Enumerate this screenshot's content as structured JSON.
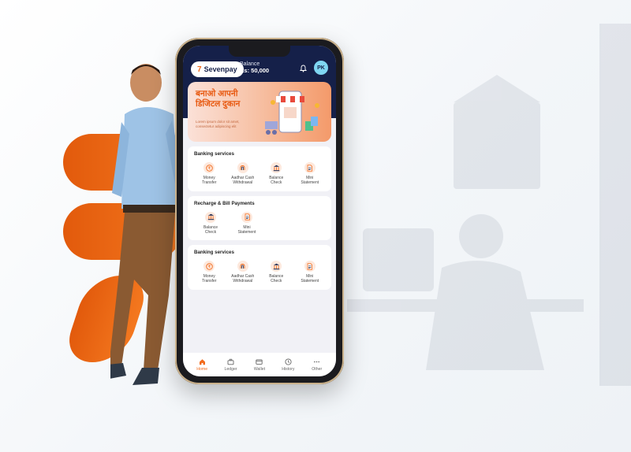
{
  "colors": {
    "brand_navy": "#152049",
    "accent_orange": "#f26a1b",
    "screen_bg": "#f1f1f6"
  },
  "header": {
    "logo_text": "Sevenpay",
    "balance_label": "Balance",
    "balance_value": "Rs: 50,000",
    "bell_icon": "bell-icon",
    "avatar_initials": "PK"
  },
  "banner": {
    "title_line1": "बनाओ आपनी",
    "title_line2": "डिजिटल दुकान",
    "subtitle": "Lorem ipsum dolor sit amet, consectetur adipiscing elit"
  },
  "sections": [
    {
      "title": "Banking services",
      "items": [
        {
          "label_line1": "Money",
          "label_line2": "Transfer",
          "icon": "rupee-icon"
        },
        {
          "label_line1": "Aadhar Cash",
          "label_line2": "Withdrawal",
          "icon": "fingerprint-icon"
        },
        {
          "label_line1": "Balance",
          "label_line2": "Check",
          "icon": "bank-icon"
        },
        {
          "label_line1": "Mini",
          "label_line2": "Statement",
          "icon": "document-icon"
        }
      ]
    },
    {
      "title": "Recharge & Bill Payments",
      "items": [
        {
          "label_line1": "Balance",
          "label_line2": "Check",
          "icon": "bank-icon"
        },
        {
          "label_line1": "Mini",
          "label_line2": "Statement",
          "icon": "document-icon"
        }
      ]
    },
    {
      "title": "Banking services",
      "items": [
        {
          "label_line1": "Money",
          "label_line2": "Transfer",
          "icon": "rupee-icon"
        },
        {
          "label_line1": "Aadhar Cash",
          "label_line2": "Withdrawal",
          "icon": "fingerprint-icon"
        },
        {
          "label_line1": "Balance",
          "label_line2": "Check",
          "icon": "bank-icon"
        },
        {
          "label_line1": "Mini",
          "label_line2": "Statement",
          "icon": "document-icon"
        }
      ]
    }
  ],
  "tabbar": [
    {
      "label": "Home",
      "icon": "home-icon",
      "active": true
    },
    {
      "label": "Ledger",
      "icon": "briefcase-icon",
      "active": false
    },
    {
      "label": "Wallet",
      "icon": "wallet-icon",
      "active": false
    },
    {
      "label": "History",
      "icon": "clock-icon",
      "active": false
    },
    {
      "label": "Other",
      "icon": "more-icon",
      "active": false
    }
  ]
}
